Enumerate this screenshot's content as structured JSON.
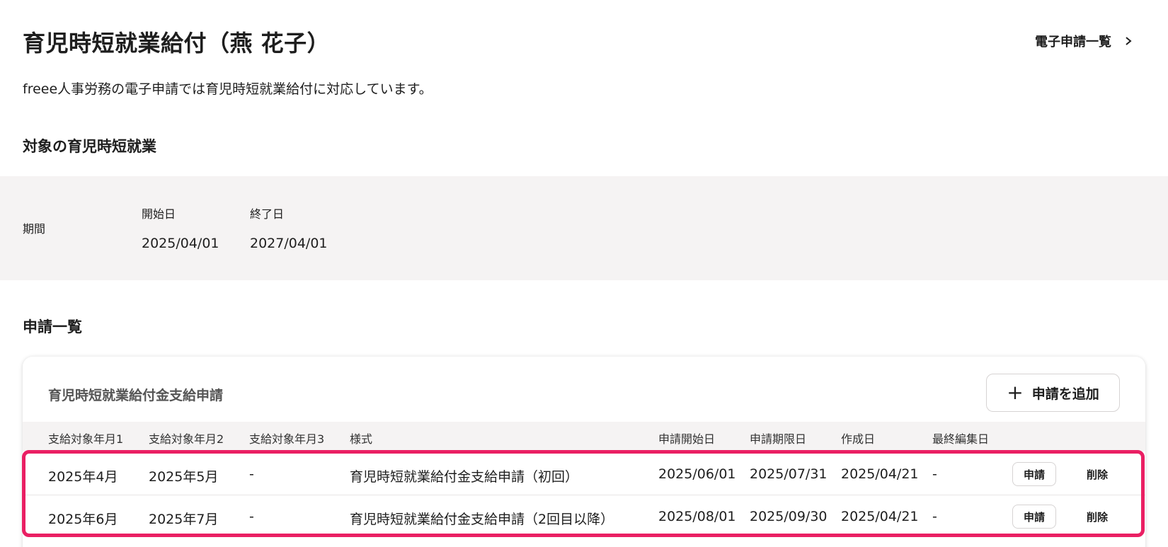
{
  "header": {
    "title": "育児時短就業給付（燕 花子）",
    "nav_link_label": "電子申請一覧",
    "nav_link_icon": "chevron-right-icon"
  },
  "description": "freee人事労務の電子申請では育児時短就業給付に対応しています。",
  "target_section": {
    "heading": "対象の育児時短就業",
    "period_label": "期間",
    "start_label": "開始日",
    "start_value": "2025/04/01",
    "end_label": "終了日",
    "end_value": "2027/04/01"
  },
  "applications_section": {
    "heading": "申請一覧",
    "card_title": "育児時短就業給付金支給申請",
    "add_button_label": "申請を追加",
    "add_button_icon": "plus-icon",
    "columns": [
      "支給対象年月1",
      "支給対象年月2",
      "支給対象年月3",
      "様式",
      "申請開始日",
      "申請期限日",
      "作成日",
      "最終編集日"
    ],
    "rows": [
      {
        "month1": "2025年4月",
        "month2": "2025年5月",
        "month3": "-",
        "form": "育児時短就業給付金支給申請（初回）",
        "start_date": "2025/06/01",
        "deadline": "2025/07/31",
        "created": "2025/04/21",
        "last_edited": "-",
        "apply_label": "申請",
        "delete_label": "削除"
      },
      {
        "month1": "2025年6月",
        "month2": "2025年7月",
        "month3": "-",
        "form": "育児時短就業給付金支給申請（2回目以降）",
        "start_date": "2025/08/01",
        "deadline": "2025/09/30",
        "created": "2025/04/21",
        "last_edited": "-",
        "apply_label": "申請",
        "delete_label": "削除"
      }
    ]
  },
  "colors": {
    "highlight": "#ea1f63",
    "band_background": "#f5f3f3"
  }
}
